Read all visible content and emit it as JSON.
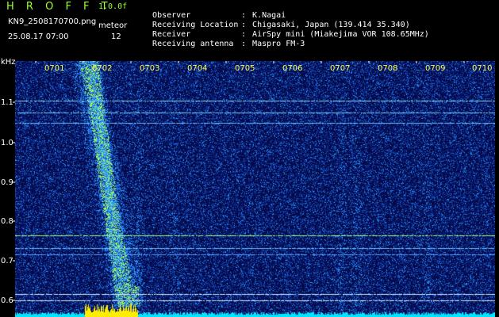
{
  "header": {
    "brand": "H R O F F T",
    "version": "1.0.0f",
    "filename": "KN9_2508170700.png",
    "timestamp": "25.08.17 07:00",
    "meteor_label": "meteor",
    "meteor_count": "12"
  },
  "info": [
    {
      "key": "Observer",
      "sep": ":",
      "value": "K.Nagai"
    },
    {
      "key": "Receiving Location",
      "sep": ":",
      "value": "Chigasaki, Japan (139.414 35.340)"
    },
    {
      "key": "Receiver",
      "sep": ":",
      "value": "AirSpy mini (Miakejima VOR 108.65MHz)"
    },
    {
      "key": "Receiving antenna",
      "sep": ":",
      "value": "Maspro FM-3"
    }
  ],
  "axis": {
    "y_unit": "kHz",
    "y_ticks": [
      "1.1",
      "1.0",
      "0.9",
      "0.8",
      "0.7",
      "0.6"
    ],
    "x_ticks": [
      "0701",
      "0702",
      "0703",
      "0704",
      "0705",
      "0706",
      "0707",
      "0708",
      "0709",
      "0710"
    ]
  },
  "colors": {
    "background": "#050a4a",
    "noise_bright": "#3ab0ff",
    "signal_line": "#7fd0ff",
    "meteor": "#a8ff4a",
    "bottom_bar": "#00e5ff",
    "bottom_peak": "#ffee00",
    "tick_label": "#ffff55"
  }
}
